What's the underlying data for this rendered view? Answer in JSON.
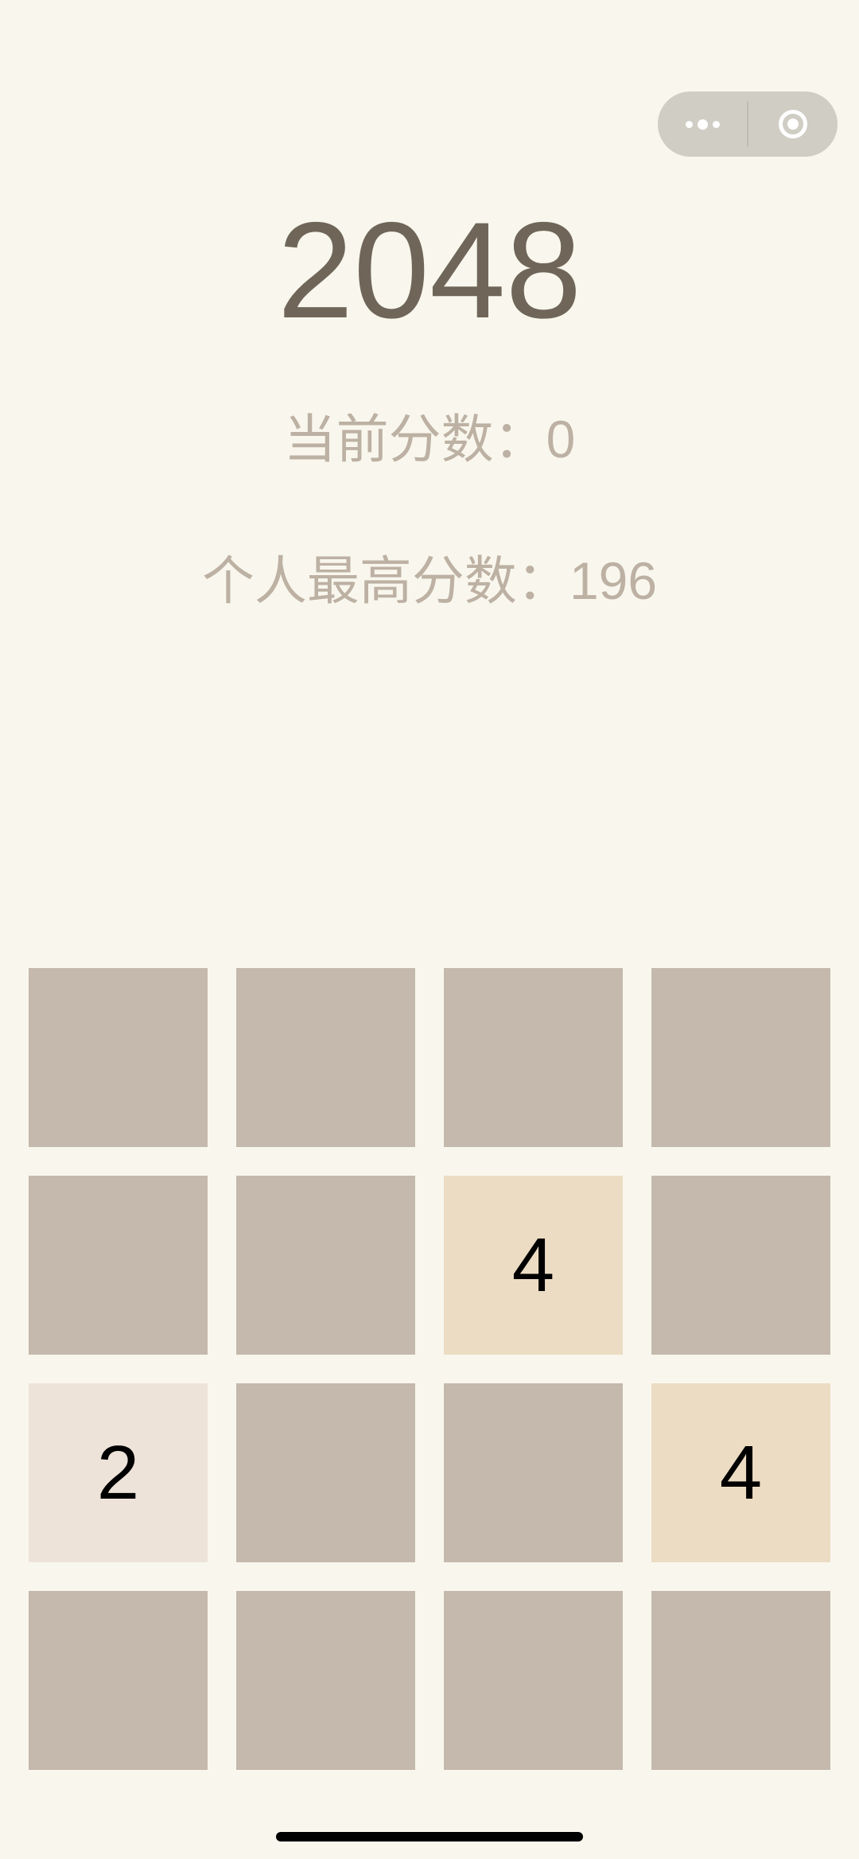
{
  "capsule": {
    "menu_icon": "more-dots-icon",
    "close_icon": "target-circle-icon"
  },
  "title": "2048",
  "scores": {
    "current_label": "当前分数：",
    "current_value": "0",
    "best_label": "个人最高分数：",
    "best_value": "196"
  },
  "board": {
    "size": 4,
    "cells": [
      [
        "",
        "",
        "",
        ""
      ],
      [
        "",
        "",
        "4",
        ""
      ],
      [
        "2",
        "",
        "",
        "4"
      ],
      [
        "",
        "",
        "",
        ""
      ]
    ]
  },
  "colors": {
    "background": "#f9f7ed",
    "title": "#6f6659",
    "score_text": "#bdb1a4",
    "empty_tile": "#c5b8ad",
    "tile_2": "#ede3d9",
    "tile_4": "#ebdcc3",
    "capsule": "#cfcdc4"
  }
}
